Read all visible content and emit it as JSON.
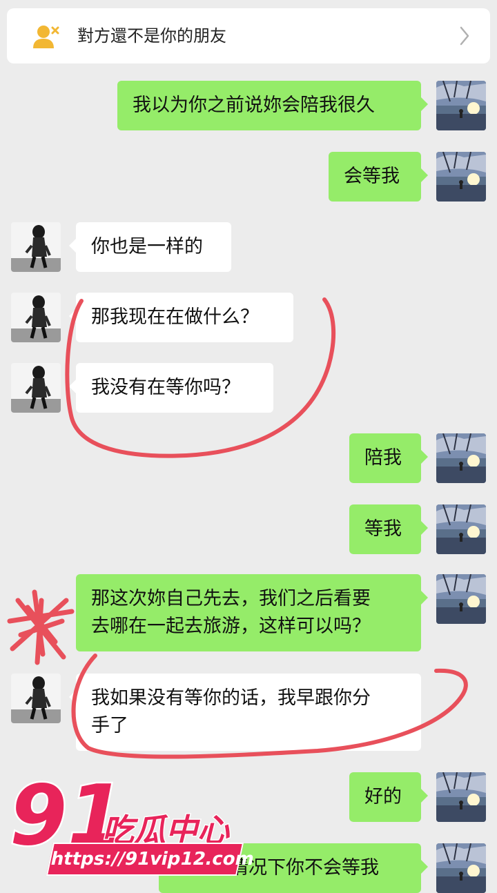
{
  "banner": {
    "text": "對方還不是你的朋友",
    "icon": "user-remove-icon",
    "chevron": "chevron-right-icon"
  },
  "messages": [
    {
      "side": "me",
      "text": "我以为你之前说妳会陪我很久"
    },
    {
      "side": "me",
      "text": "会等我"
    },
    {
      "side": "them",
      "text": "你也是一样的"
    },
    {
      "side": "them",
      "text": "那我现在在做什么？"
    },
    {
      "side": "them",
      "text": "我没有在等你吗？"
    },
    {
      "side": "me",
      "text": "陪我"
    },
    {
      "side": "me",
      "text": "等我"
    },
    {
      "side": "me",
      "text": "那这次妳自己先去，我们之后看要\n去哪在一起去旅游，这样可以吗？"
    },
    {
      "side": "them",
      "text": "我如果没有等你的话，我早跟你分\n手了"
    },
    {
      "side": "me",
      "text": "好的"
    },
    {
      "side": "me",
      "text": "那什么情况下你不会等我"
    }
  ],
  "watermark": {
    "number": "91",
    "brand": "吃瓜中心",
    "url": "https://91vip12.com"
  },
  "colors": {
    "background": "#ececec",
    "my_bubble": "#95ec69",
    "their_bubble": "#ffffff",
    "annotation": "#e8505b",
    "watermark": "#e8245a"
  }
}
